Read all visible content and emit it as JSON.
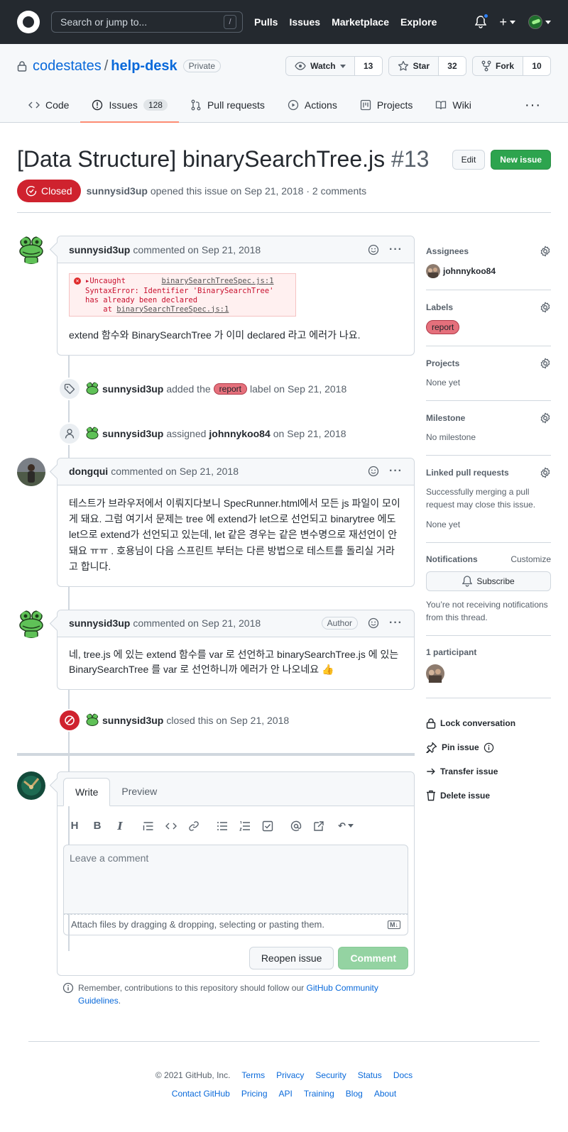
{
  "header": {
    "search_placeholder": "Search or jump to...",
    "search_shortcut": "/",
    "nav": [
      "Pulls",
      "Issues",
      "Marketplace",
      "Explore"
    ],
    "plus": "+"
  },
  "repo": {
    "owner": "codestates",
    "separator": "/",
    "name": "help-desk",
    "visibility": "Private",
    "watch_label": "Watch",
    "watch_count": "13",
    "star_label": "Star",
    "star_count": "32",
    "fork_label": "Fork",
    "fork_count": "10",
    "tabs": [
      {
        "label": "Code",
        "icon": "code-icon"
      },
      {
        "label": "Issues",
        "icon": "issue-icon",
        "counter": "128"
      },
      {
        "label": "Pull requests",
        "icon": "pull-request-icon"
      },
      {
        "label": "Actions",
        "icon": "play-icon"
      },
      {
        "label": "Projects",
        "icon": "project-icon"
      },
      {
        "label": "Wiki",
        "icon": "book-icon"
      }
    ],
    "more": "···"
  },
  "issue": {
    "title": "[Data Structure] binarySearchTree.js",
    "number": "#13",
    "edit_label": "Edit",
    "new_issue_label": "New issue",
    "state": "Closed",
    "author": "sunnysid3up",
    "meta": "opened this issue on Sep 21, 2018 · 2 comments"
  },
  "timeline": {
    "comment1": {
      "author": "sunnysid3up",
      "action": "commented on Sep 21, 2018",
      "error_line1": "Uncaught",
      "error_file": "binarySearchTreeSpec.js:1",
      "error_line2": "SyntaxError: Identifier 'BinarySearchTree'",
      "error_line3": "has already been declared",
      "error_line4_prefix": "at",
      "error_line4_file": "binarySearchTreeSpec.js:1",
      "body": "extend 함수와 BinarySearchTree 가 이미 declared 라고 에러가 나요."
    },
    "event_label": {
      "actor": "sunnysid3up",
      "text_before": "added the",
      "label": "report",
      "text_after": "label on Sep 21, 2018"
    },
    "event_assign": {
      "actor": "sunnysid3up",
      "text": "assigned",
      "assignee": "johnnykoo84",
      "date": "on Sep 21, 2018"
    },
    "comment2": {
      "author": "dongqui",
      "action": "commented on Sep 21, 2018",
      "body": "테스트가 브라우저에서 이뤄지다보니 SpecRunner.html에서 모든 js 파일이 모이게 돼요. 그럼 여기서 문제는 tree 에 extend가 let으로 선언되고 binarytree 에도 let으로 extend가 선언되고 있는데, let 같은 경우는 같은 변수명으로 재선언이 안돼요 ㅠㅠ . 호용님이 다음 스프린트 부터는 다른 방법으로 테스트를 돌리실 거라고 합니다."
    },
    "comment3": {
      "author": "sunnysid3up",
      "action": "commented on Sep 21, 2018",
      "badge": "Author",
      "body": "네, tree.js 에 있는 extend 함수를 var 로 선언하고 binarySearchTree.js 에 있는 BinarySearchTree 를 var 로 선언하니까 에러가 안 나오네요 👍"
    },
    "event_closed": {
      "actor": "sunnysid3up",
      "text": "closed this on Sep 21, 2018"
    }
  },
  "composer": {
    "tab_write": "Write",
    "tab_preview": "Preview",
    "placeholder": "Leave a comment",
    "attach_text": "Attach files by dragging & dropping, selecting or pasting them.",
    "md_badge": "M↓",
    "reopen_label": "Reopen issue",
    "comment_label": "Comment",
    "tip_prefix": "Remember, contributions to this repository should follow our",
    "tip_link": "GitHub Community Guidelines",
    "tip_suffix": "."
  },
  "sidebar": {
    "assignees_title": "Assignees",
    "assignee": "johnnykoo84",
    "labels_title": "Labels",
    "label": "report",
    "projects_title": "Projects",
    "projects_value": "None yet",
    "milestone_title": "Milestone",
    "milestone_value": "No milestone",
    "linked_title": "Linked pull requests",
    "linked_desc": "Successfully merging a pull request may close this issue.",
    "linked_value": "None yet",
    "notifications_title": "Notifications",
    "customize": "Customize",
    "subscribe_label": "Subscribe",
    "notif_desc": "You’re not receiving notifications from this thread.",
    "participants_title": "1 participant",
    "lock_label": "Lock conversation",
    "pin_label": "Pin issue",
    "transfer_label": "Transfer issue",
    "delete_label": "Delete issue"
  },
  "footer": {
    "copyright": "© 2021 GitHub, Inc.",
    "row1": [
      "Terms",
      "Privacy",
      "Security",
      "Status",
      "Docs"
    ],
    "row2": [
      "Contact GitHub",
      "Pricing",
      "API",
      "Training",
      "Blog",
      "About"
    ]
  },
  "colors": {
    "closed": "#cf222e",
    "accent_green": "#2da44e",
    "label_report": "#e5707c",
    "link": "#0969da"
  }
}
